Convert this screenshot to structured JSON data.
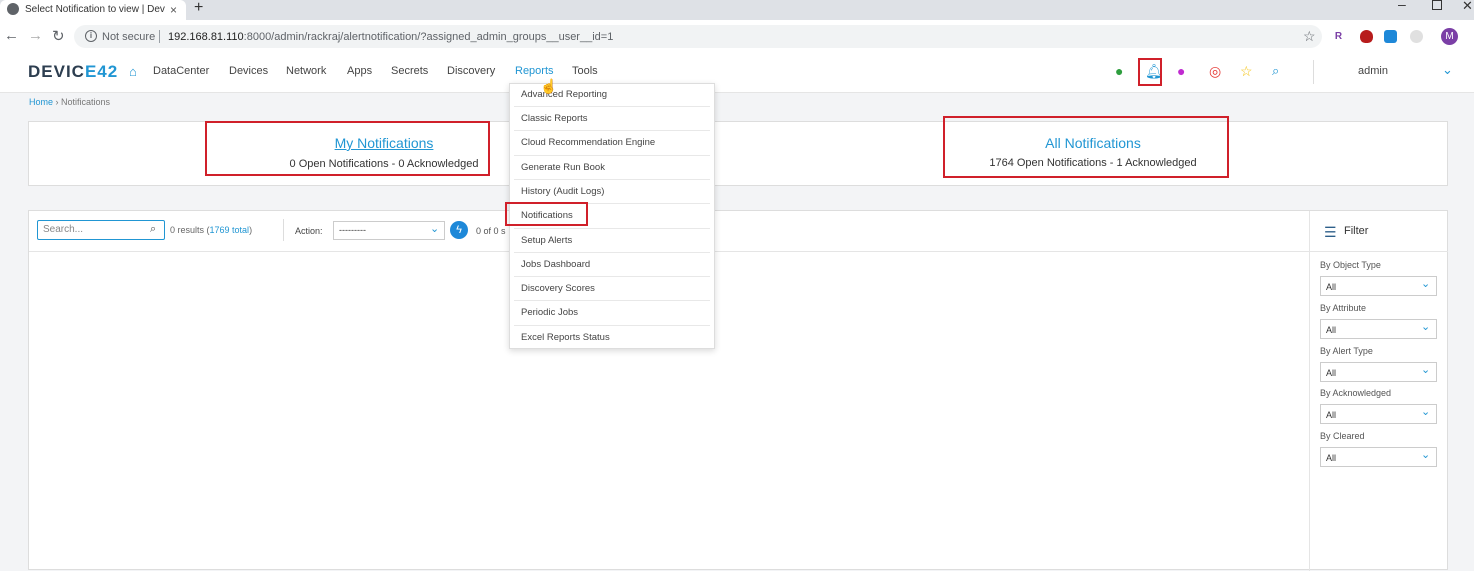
{
  "browser": {
    "tab_title": "Select Notification to view | Devi",
    "tab_close": "×",
    "new_tab": "+",
    "not_secure": "Not secure",
    "url_host": "192.168.81.110",
    "url_rest": ":8000/admin/rackraj/alertnotification/?assigned_admin_groups__user__id=1",
    "profile_initial": "M",
    "ext_r": "R"
  },
  "header": {
    "logo_a": "DEVIC",
    "logo_b": "E42",
    "nav": [
      "DataCenter",
      "Devices",
      "Network",
      "Apps",
      "Secrets",
      "Discovery",
      "Reports",
      "Tools"
    ],
    "user": "admin"
  },
  "breadcrumb": {
    "home": "Home",
    "sep": " › ",
    "current": "Notifications"
  },
  "summary": {
    "my_title": "My Notifications",
    "my_sub": "0  Open Notifications  - 0 Acknowledged",
    "all_title": "All Notifications",
    "all_sub": "1764  Open Notifications  - 1 Acknowledged"
  },
  "toolbar": {
    "search_placeholder": "Search...",
    "results_prefix": "0 results (",
    "results_total": "1769 total",
    "results_suffix": ")",
    "action_label": "Action:",
    "action_value": "---------",
    "selected_count": "0 of 0 s"
  },
  "filter": {
    "title": "Filter",
    "groups": [
      {
        "label": "By Object Type",
        "value": "All"
      },
      {
        "label": "By Attribute",
        "value": "All"
      },
      {
        "label": "By Alert Type",
        "value": "All"
      },
      {
        "label": "By Acknowledged",
        "value": "All"
      },
      {
        "label": "By Cleared",
        "value": "All"
      }
    ]
  },
  "reports_menu": [
    "Advanced Reporting",
    "Classic Reports",
    "Cloud Recommendation Engine",
    "Generate Run Book",
    "History (Audit Logs)",
    "Notifications",
    "Setup Alerts",
    "Jobs Dashboard",
    "Discovery Scores",
    "Periodic Jobs",
    "Excel Reports Status"
  ],
  "colors": {
    "accent": "#2196d3",
    "highlight": "#d0202a"
  }
}
